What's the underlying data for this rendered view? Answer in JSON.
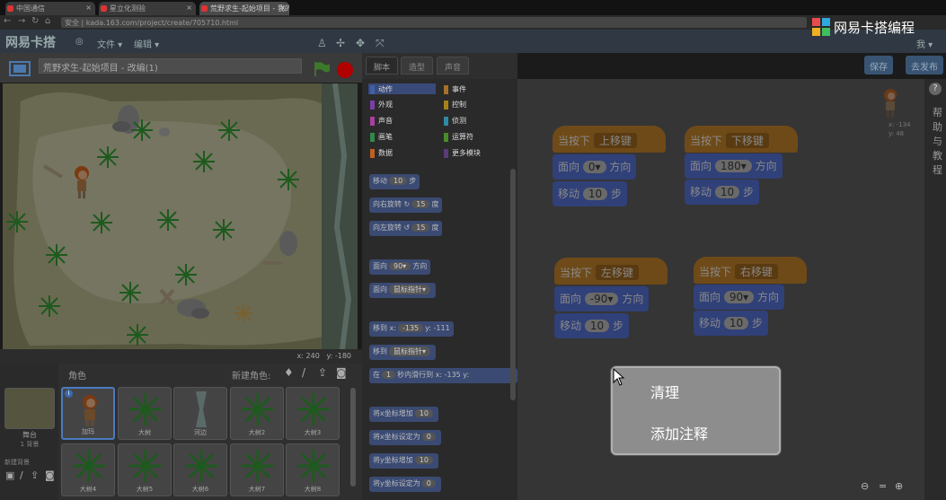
{
  "browser": {
    "tabs": [
      {
        "title": "中国通信"
      },
      {
        "title": "星立化测验"
      },
      {
        "title": "荒野求生-起始项目 - 我的"
      }
    ],
    "address": "kada.163.com/project/create/705710.html",
    "secure_label": "安全"
  },
  "brand": {
    "name": "网易卡搭编程"
  },
  "menubar": {
    "logo": "网易卡搭",
    "items": [
      "文件 ▾",
      "编辑 ▾"
    ],
    "user": "我 ▾"
  },
  "project": {
    "title": "荒野求生-起始项目 - 改编(1)"
  },
  "stage": {
    "coord_x_label": "x:",
    "coord_x": "240",
    "coord_y_label": "y:",
    "coord_y": "-180"
  },
  "sprites": {
    "header": "角色",
    "new_sprite_label": "新建角色:",
    "stage_label": "舞台",
    "stage_sub": "1 背景",
    "new_backdrop_label": "新建背景",
    "items": [
      "加玛",
      "大树",
      "河边",
      "大树2",
      "大树3",
      "大树4",
      "大树5",
      "大树6",
      "大树7",
      "大树8"
    ]
  },
  "tabs": [
    "脚本",
    "造型",
    "声音"
  ],
  "actions": {
    "save": "保存",
    "publish": "去发布"
  },
  "categories": [
    {
      "label": "动作",
      "color": "#3f5fa8"
    },
    {
      "label": "事件",
      "color": "#a8702a"
    },
    {
      "label": "外观",
      "color": "#7a3fa8"
    },
    {
      "label": "控制",
      "color": "#a8801a"
    },
    {
      "label": "声音",
      "color": "#a83fa0"
    },
    {
      "label": "侦测",
      "color": "#2f8aa8"
    },
    {
      "label": "画笔",
      "color": "#2f8a4a"
    },
    {
      "label": "运算符",
      "color": "#4a8a2a"
    },
    {
      "label": "数据",
      "color": "#c06020"
    },
    {
      "label": "更多模块",
      "color": "#5a3a7a"
    }
  ],
  "palette_blocks": [
    {
      "text": "移动",
      "pill": "10",
      "suffix": "步"
    },
    {
      "text": "向右旋转 ↻",
      "pill": "15",
      "suffix": "度"
    },
    {
      "text": "向左旋转 ↺",
      "pill": "15",
      "suffix": "度"
    },
    {
      "text": "面向",
      "pill": "90▾",
      "suffix": "方向"
    },
    {
      "text": "面向",
      "pill": "鼠标指针▾",
      "suffix": ""
    },
    {
      "text": "移到 x:",
      "pill": "-135",
      "suffix": "y: -111"
    },
    {
      "text": "移到",
      "pill": "鼠标指针▾",
      "suffix": ""
    },
    {
      "text": "在",
      "pill": "1",
      "suffix": "秒内滑行到 x: -135 y:"
    },
    {
      "text": "将x坐标增加",
      "pill": "10",
      "suffix": ""
    },
    {
      "text": "将x坐标设定为",
      "pill": "0",
      "suffix": ""
    },
    {
      "text": "将y坐标增加",
      "pill": "10",
      "suffix": ""
    },
    {
      "text": "将y坐标设定为",
      "pill": "0",
      "suffix": ""
    }
  ],
  "scripts": [
    {
      "hat": "当按下",
      "key": "上移键",
      "dir_label": "面向",
      "dir": "0",
      "dir_suffix": "方向",
      "move_label": "移动",
      "move": "10",
      "move_suffix": "步"
    },
    {
      "hat": "当按下",
      "key": "下移键",
      "dir_label": "面向",
      "dir": "180",
      "dir_suffix": "方向",
      "move_label": "移动",
      "move": "10",
      "move_suffix": "步"
    },
    {
      "hat": "当按下",
      "key": "左移键",
      "dir_label": "面向",
      "dir": "-90",
      "dir_suffix": "方向",
      "move_label": "移动",
      "move": "10",
      "move_suffix": "步"
    },
    {
      "hat": "当按下",
      "key": "右移键",
      "dir_label": "面向",
      "dir": "90",
      "dir_suffix": "方向",
      "move_label": "移动",
      "move": "10",
      "move_suffix": "步"
    }
  ],
  "sprite_info": {
    "x": "x: -134",
    "y": "y: 48"
  },
  "context_menu": {
    "items": [
      "清理",
      "添加注释"
    ]
  },
  "help": {
    "label": "帮助与教程"
  }
}
